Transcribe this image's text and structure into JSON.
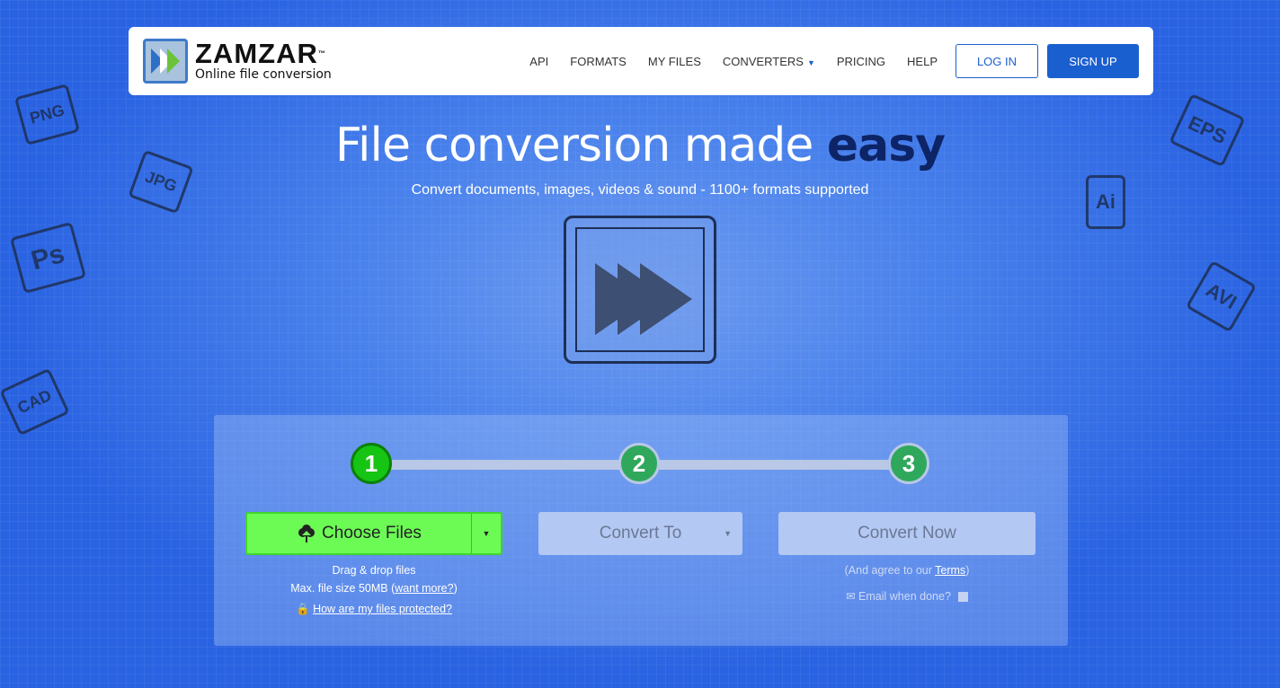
{
  "nav": {
    "logo_title": "ZAMZAR",
    "logo_tm": "™",
    "logo_subtitle": "Online file conversion",
    "items": [
      "API",
      "FORMATS",
      "MY FILES",
      "CONVERTERS",
      "PRICING",
      "HELP"
    ],
    "login": "LOG IN",
    "signup": "SIGN UP"
  },
  "hero": {
    "title": "File conversion made ",
    "title_emphasis": "easy",
    "subtitle": "Convert documents, images, videos & sound - 1100+ formats supported"
  },
  "decor_labels": [
    "PNG",
    "JPG",
    "Ps",
    "CAD",
    "EPS",
    "Ai",
    "AVI"
  ],
  "steps": [
    "1",
    "2",
    "3"
  ],
  "converter": {
    "choose_files": "Choose Files",
    "convert_to": "Convert To",
    "convert_now": "Convert Now",
    "drag_drop": "Drag & drop files",
    "max_size": "Max. file size 50MB (",
    "want_more": "want more?",
    "max_size_end": ")",
    "protected": "How are my files protected?",
    "agree_pre": "(And agree to our ",
    "terms": "Terms",
    "agree_post": ")",
    "email_when_done": "Email when done?"
  },
  "colors": {
    "brand": "#1a5fd0",
    "choose_green": "#6cfa55",
    "step_active": "#16c413"
  }
}
